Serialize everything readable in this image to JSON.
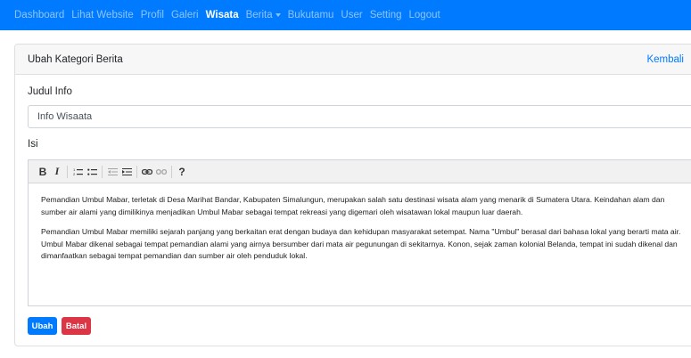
{
  "navbar": {
    "items": [
      {
        "label": "Dashboard"
      },
      {
        "label": "Lihat Website"
      },
      {
        "label": "Profil"
      },
      {
        "label": "Galeri"
      },
      {
        "label": "Wisata",
        "active": true
      },
      {
        "label": "Berita",
        "dropdown": true
      },
      {
        "label": "Bukutamu"
      },
      {
        "label": "User"
      },
      {
        "label": "Setting"
      },
      {
        "label": "Logout"
      }
    ],
    "color": "#007bff"
  },
  "card": {
    "title": "Ubah Kategori Berita",
    "back_label": "Kembali"
  },
  "form": {
    "title_label": "Judul Info",
    "title_value": "Info Wisaata",
    "content_label": "Isi"
  },
  "editor": {
    "toolbar": [
      "bold-icon",
      "italic-icon",
      "ordered-list-icon",
      "unordered-list-icon",
      "outdent-icon",
      "indent-icon",
      "link-icon",
      "unlink-icon",
      "help-icon"
    ],
    "paragraphs": [
      "Pemandian Umbul Mabar, terletak di Desa Marihat Bandar, Kabupaten Simalungun, merupakan salah satu destinasi wisata alam yang menarik di Sumatera Utara. Keindahan alam dan sumber air alami yang dimilikinya menjadikan Umbul Mabar sebagai tempat rekreasi yang digemari oleh wisatawan lokal maupun luar daerah.",
      "Pemandian Umbul Mabar memiliki sejarah panjang yang berkaitan erat dengan budaya dan kehidupan masyarakat setempat. Nama \"Umbul\" berasal dari bahasa lokal yang berarti mata air. Umbul Mabar dikenal sebagai tempat pemandian alami yang airnya bersumber dari mata air pegunungan di sekitarnya. Konon, sejak zaman kolonial Belanda, tempat ini sudah dikenal dan dimanfaatkan sebagai tempat pemandian dan sumber air oleh penduduk lokal."
    ]
  },
  "buttons": {
    "submit_label": "Ubah",
    "cancel_label": "Batal",
    "primary_color": "#007bff",
    "danger_color": "#dc3545"
  }
}
